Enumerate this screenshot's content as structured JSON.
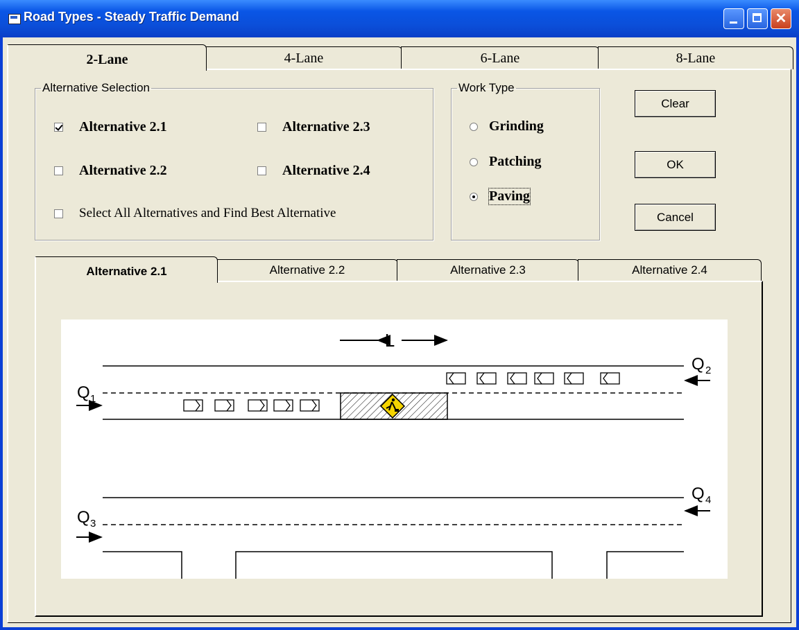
{
  "window": {
    "title": "Road Types - Steady Traffic Demand"
  },
  "lane_tabs": [
    "2-Lane",
    "4-Lane",
    "6-Lane",
    "8-Lane"
  ],
  "alternative_group": {
    "legend": "Alternative Selection",
    "items": [
      {
        "label": "Alternative 2.1",
        "checked": true
      },
      {
        "label": "Alternative 2.3",
        "checked": false
      },
      {
        "label": "Alternative 2.2",
        "checked": false
      },
      {
        "label": "Alternative 2.4",
        "checked": false
      }
    ],
    "select_all": {
      "label": "Select All Alternatives and Find Best Alternative",
      "checked": false
    }
  },
  "work_type": {
    "legend": "Work Type",
    "options": [
      {
        "label": "Grinding",
        "selected": false
      },
      {
        "label": "Patching",
        "selected": false
      },
      {
        "label": "Paving",
        "selected": true
      }
    ]
  },
  "buttons": {
    "clear": "Clear",
    "ok": "OK",
    "cancel": "Cancel"
  },
  "alt_tabs": [
    "Alternative 2.1",
    "Alternative 2.2",
    "Alternative 2.3",
    "Alternative 2.4"
  ],
  "diagram": {
    "length_label": "L",
    "flows": {
      "q1": "Q",
      "q1_sub": "1",
      "q2": "Q",
      "q2_sub": "2",
      "q3": "Q",
      "q3_sub": "3",
      "q4": "Q",
      "q4_sub": "4"
    }
  }
}
